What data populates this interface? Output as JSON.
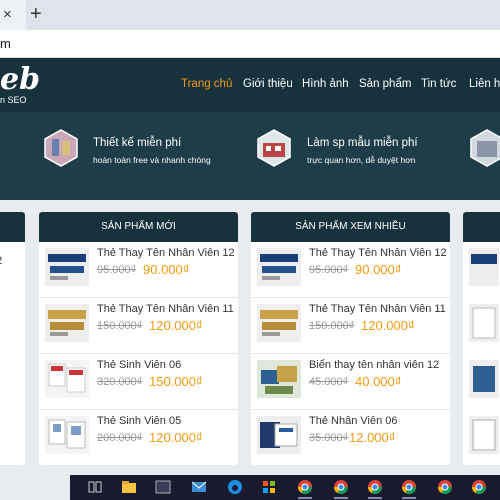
{
  "browser": {
    "close_glyph": "×",
    "newtab_glyph": "+",
    "address_text": "m"
  },
  "site": {
    "logo": "eb",
    "logo_sub": "n SEO"
  },
  "nav": [
    {
      "label": "Trang chủ",
      "active": true
    },
    {
      "label": "Giới thiệu",
      "active": false
    },
    {
      "label": "Hình ảnh",
      "active": false
    },
    {
      "label": "Sản phẩm",
      "active": false
    },
    {
      "label": "Tin tức",
      "active": false
    },
    {
      "label": "Liên hệ",
      "active": false
    }
  ],
  "features": [
    {
      "title": "Thiết kế miễn phí",
      "subtitle": "hoàn toàn free và nhanh chóng"
    },
    {
      "title": "Làm sp mẫu miễn phí",
      "subtitle": "trực quan hơn, dễ duyệt hơn"
    }
  ],
  "left_card": {
    "item_suffix": "12"
  },
  "new_products": {
    "title": "SẢN PHẨM MỚI",
    "items": [
      {
        "name": "Thẻ Thay Tên Nhân Viên 12",
        "old": "95.000₫",
        "new": "90.000₫"
      },
      {
        "name": "Thẻ Thay Tên Nhân Viên 11",
        "old": "150.000₫",
        "new": "120.000₫"
      },
      {
        "name": "Thẻ Sinh Viên 06",
        "old": "320.000₫",
        "new": "150.000₫"
      },
      {
        "name": "Thẻ Sinh Viên 05",
        "old": "200.000₫",
        "new": "120.000₫"
      }
    ]
  },
  "most_viewed": {
    "title": "SẢN PHẨM XEM NHIỀU",
    "items": [
      {
        "name": "Thẻ Thay Tên Nhân Viên 12",
        "old": "95.000₫",
        "new": "90.000₫"
      },
      {
        "name": "Thẻ Thay Tên Nhân Viên 11",
        "old": "150.000₫",
        "new": "120.000₫"
      },
      {
        "name": "Biển thay tên nhân viên 12",
        "old": "45.000₫",
        "new": "40.000₫"
      },
      {
        "name": "Thẻ Nhân Viên 06",
        "old": "35.000₫",
        "new": "12.000₫"
      }
    ]
  },
  "colors": {
    "nav_bg": "#17323c",
    "feature_bg": "#1e3d48",
    "accent": "#f39c12"
  },
  "taskbar": [
    "task-view-icon",
    "file-explorer-icon",
    "mail-icon",
    "edge-icon",
    "app-icon",
    "chrome-icon",
    "chrome-icon",
    "chrome-icon",
    "chrome-icon",
    "chrome-icon",
    "chrome-icon"
  ]
}
